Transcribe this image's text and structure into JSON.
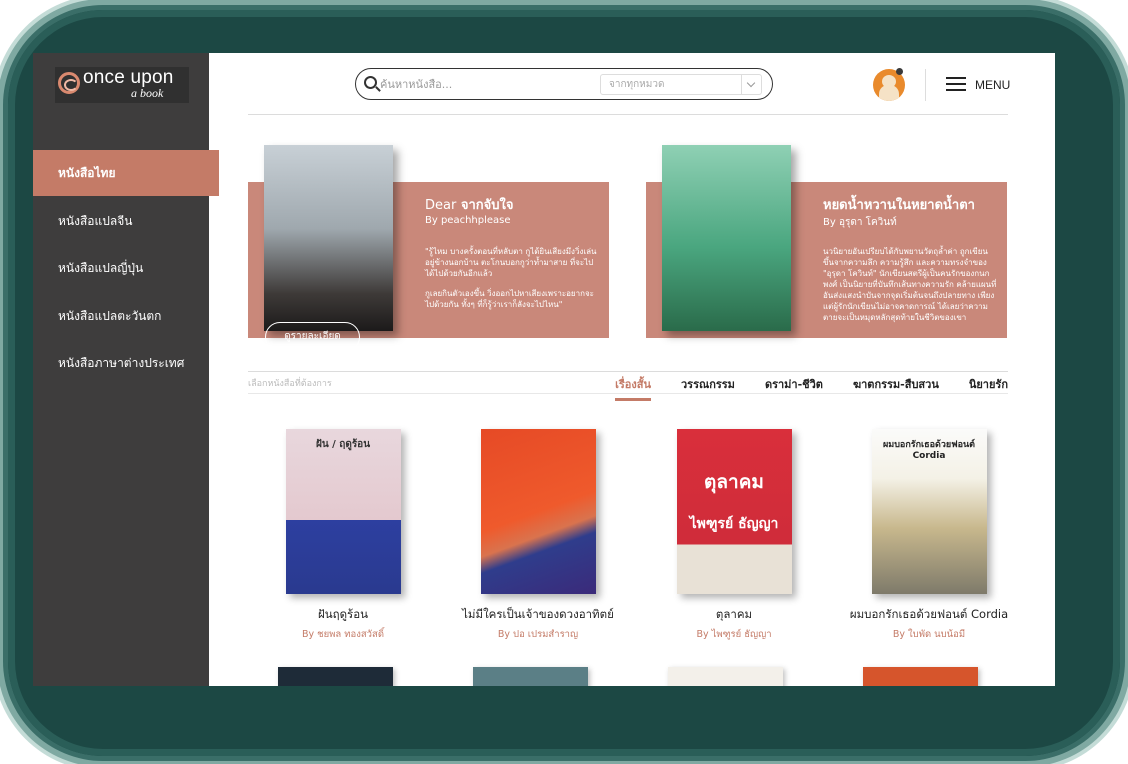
{
  "brand": {
    "name": "once upon",
    "sub": "a book"
  },
  "sidebar": {
    "items": [
      {
        "label": "หนังสือไทย",
        "active": true
      },
      {
        "label": "หนังสือแปลจีน"
      },
      {
        "label": "หนังสือแปลญี่ปุ่น"
      },
      {
        "label": "หนังสือแปลตะวันตก"
      },
      {
        "label": "หนังสือภาษาต่างประเทศ"
      }
    ]
  },
  "header": {
    "search_placeholder": "ค้นหาหนังสือ...",
    "category_value": "จากทุกหมวด",
    "menu_label": "MENU"
  },
  "featured": [
    {
      "title_en": "Dear",
      "title_th": "จากจับใจ",
      "author": "By peachhplease",
      "desc1": "\"รู้ไหม บางครั้งตอนที่หลับตา กูได้ยินเสียงมึงวิ่งเล่นอยู่ข้างนอกบ้าน ตะโกนบอกกูว่าท้ำมาสาย ที่จะไปได้ไปด้วยกันอีกแล้ว",
      "desc2": "กูเลยกินตัวเองขึ้น วิ่งออกไปหาเสียงเพราะอยากจะไปด้วยกัน ทั้งๆ ที่ก็รู้ว่าเราก็ลังจะไปไหน\"",
      "button": "ดูรายละเอียด"
    },
    {
      "title_th": "หยดน้ำหวานในหยาดน้ำตา",
      "author": "By อุรุดา โควินท์",
      "desc1": "นวนิยายอันเปรียบได้กับพยานวัตถุล้ำค่า ถูกเขียนขึ้นจากความลึก ความรู้สึก และความทรงจำของ \"อุรุดา โควินท์\" นักเขียนสตรีผู้เป็นคนรักของกนกพงศ์ เป็นนิยายที่บันทึกเส้นทางความรัก คล้ายแผนที่อันส่งแสงนำบันจากจุดเริ่มต้นจนถึงปลายทาง เพียงแต่ผู้รักนักเขียนไม่อาจคาดการณ์ ได้เลยว่าความตายจะเป็นหมุดหลักสุดท้ายในชีวิตของเขา"
    }
  ],
  "tabs": {
    "hint": "เลือกหนังสือที่ต้องการ",
    "items": [
      "เรื่องสั้น",
      "วรรณกรรม",
      "ดราม่า-ชีวิต",
      "ฆาตกรรม-สืบสวน",
      "นิยายรัก"
    ]
  },
  "books": [
    {
      "title": "ฝันฤดูร้อน",
      "author": "By ชยพล ทองสวัสดิ์",
      "cover_top": "ฝัน / ฤดูร้อน"
    },
    {
      "title": "ไม่มีใครเป็นเจ้าของดวงอาทิตย์",
      "author": "By ปอ เปรมสำราญ"
    },
    {
      "title": "ตุลาคม",
      "author": "By ไพฑูรย์ ธัญญา",
      "cover_top": "ตุลาคม",
      "cover_bottom": "ไพฑูรย์ ธัญญา"
    },
    {
      "title": "ผมบอกรักเธอด้วยฟอนต์ Cordia",
      "author": "By ใบพัด นบน้อมี",
      "cover_top": "ผมบอกรักเธอด้วยฟอนต์ Cordia"
    }
  ]
}
